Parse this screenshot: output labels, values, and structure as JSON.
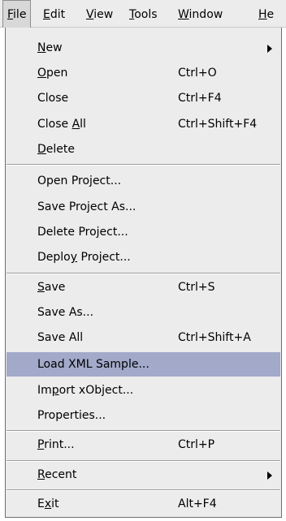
{
  "menubar": {
    "file": {
      "pre": "",
      "key": "F",
      "post": "ile"
    },
    "edit": {
      "pre": "",
      "key": "E",
      "post": "dit"
    },
    "view": {
      "pre": "",
      "key": "V",
      "post": "iew"
    },
    "tools": {
      "pre": "",
      "key": "T",
      "post": "ools"
    },
    "window": {
      "pre": "",
      "key": "W",
      "post": "indow"
    },
    "help": {
      "pre": "",
      "key": "H",
      "post": "e"
    }
  },
  "file_menu": {
    "new": {
      "pre": "",
      "key": "N",
      "post": "ew",
      "submenu_icon": "chevron-right-icon"
    },
    "open": {
      "pre": "",
      "key": "O",
      "post": "pen",
      "shortcut": "Ctrl+O"
    },
    "close": {
      "label": "Close",
      "shortcut": "Ctrl+F4"
    },
    "close_all": {
      "pre": "Close ",
      "key": "A",
      "post": "ll",
      "shortcut": "Ctrl+Shift+F4"
    },
    "delete": {
      "pre": "",
      "key": "D",
      "post": "elete"
    },
    "open_project": {
      "label": "Open Project..."
    },
    "save_project_as": {
      "label": "Save Project As..."
    },
    "delete_project": {
      "label": "Delete Project..."
    },
    "deploy_project": {
      "pre": "Deplo",
      "key": "y",
      "post": " Project..."
    },
    "save": {
      "pre": "",
      "key": "S",
      "post": "ave",
      "shortcut": "Ctrl+S"
    },
    "save_as": {
      "label": "Save As..."
    },
    "save_all": {
      "label": "Save All",
      "shortcut": "Ctrl+Shift+A"
    },
    "load_xml_sample": {
      "label": "Load XML Sample..."
    },
    "import_xobject": {
      "pre": "Im",
      "key": "p",
      "post": "ort xObject..."
    },
    "properties": {
      "label": "Properties..."
    },
    "print": {
      "pre": "",
      "key": "P",
      "post": "rint...",
      "shortcut": "Ctrl+P"
    },
    "recent": {
      "pre": "",
      "key": "R",
      "post": "ecent",
      "submenu_icon": "chevron-right-icon"
    },
    "exit": {
      "pre": "E",
      "key": "x",
      "post": "it",
      "shortcut": "Alt+F4"
    }
  },
  "colors": {
    "menu_background": "#ececec",
    "highlight": "#a2a9c9",
    "border": "#6f6f6f"
  }
}
